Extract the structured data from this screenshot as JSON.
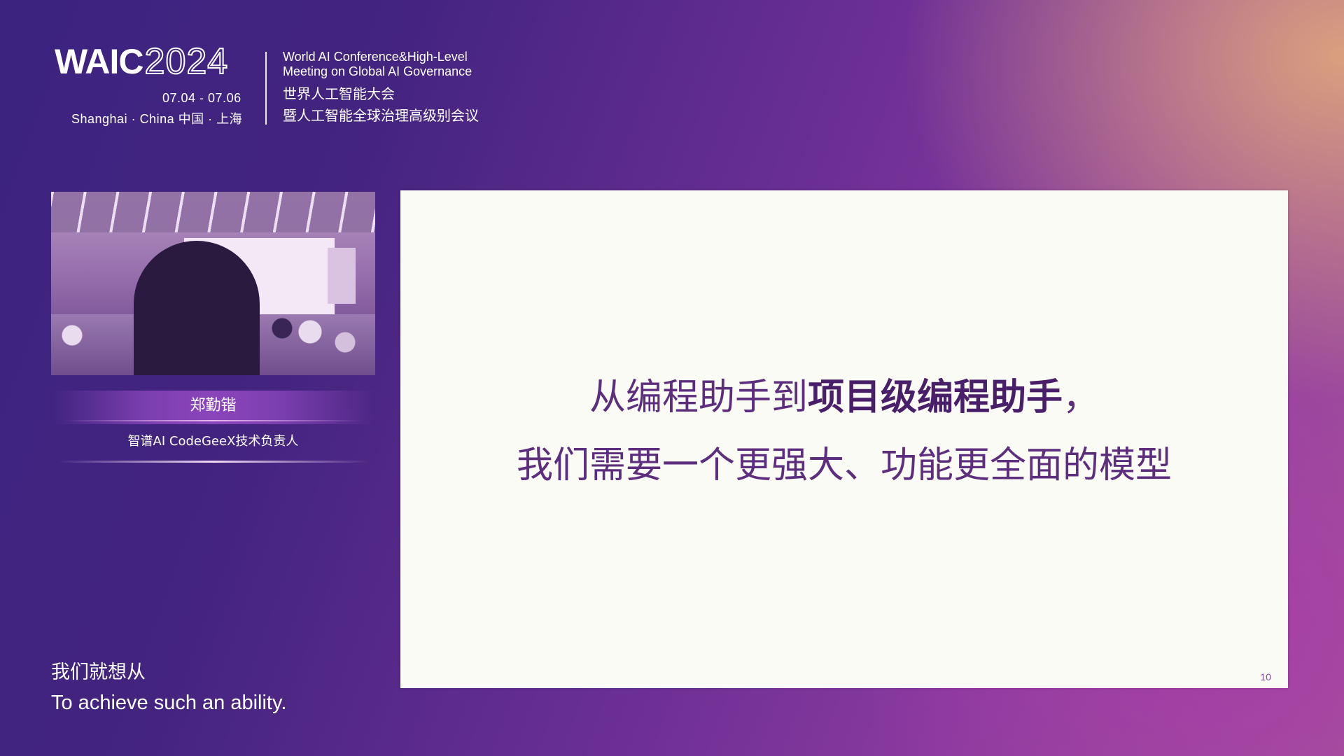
{
  "header": {
    "logo_text": "WAIC",
    "logo_year": "2024",
    "dates": "07.04 - 07.06",
    "location": "Shanghai · China  中国 · 上海",
    "conference_en_line1": "World AI Conference&High-Level",
    "conference_en_line2": "Meeting on Global AI Governance",
    "conference_zh_line1": "世界人工智能大会",
    "conference_zh_line2": "暨人工智能全球治理高级别会议"
  },
  "speaker": {
    "name": "郑勤锴",
    "title": "智谱AI  CodeGeeX技术负责人"
  },
  "slide": {
    "line1_regular": "从编程助手到",
    "line1_bold": "项目级编程助手",
    "line1_punct": "，",
    "line2": "我们需要一个更强大、功能更全面的模型",
    "page_number": "10"
  },
  "subtitles": {
    "zh": "我们就想从",
    "en": "To achieve such an ability."
  }
}
